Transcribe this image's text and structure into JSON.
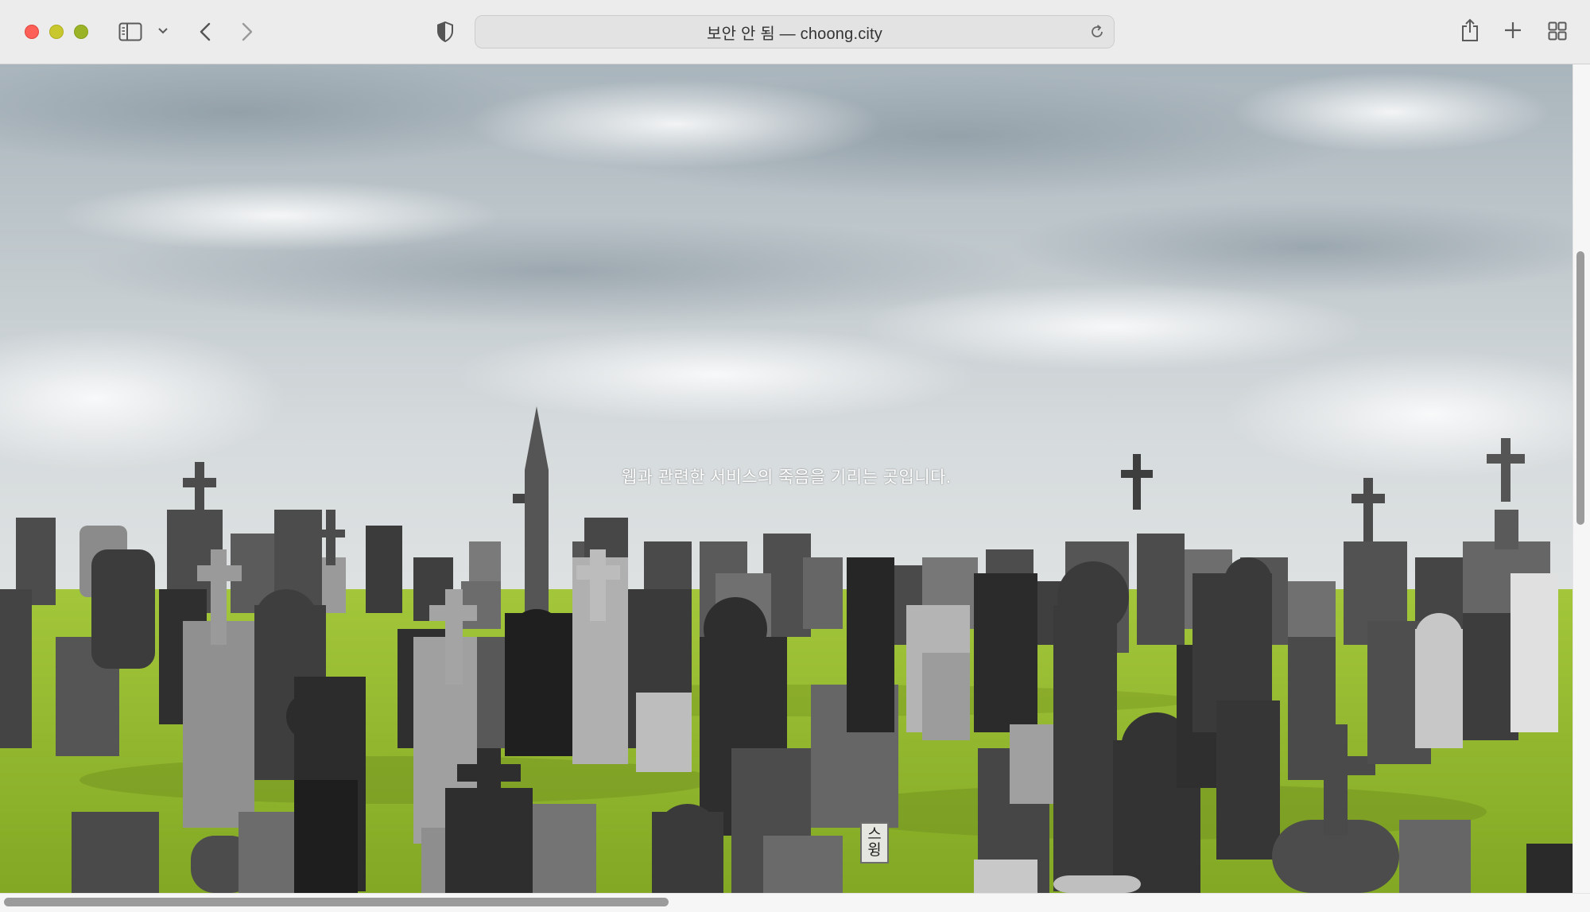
{
  "browser": {
    "address_bar": {
      "text": "보안 안 됨 — choong.city"
    },
    "icons": {
      "sidebar": "sidebar-icon",
      "sidebar_menu": "chevron-down-icon",
      "back": "chevron-left-icon",
      "forward": "chevron-right-icon",
      "privacy": "shield-icon",
      "reload": "reload-icon",
      "share": "share-icon",
      "new_tab": "plus-icon",
      "tab_overview": "grid-icon"
    }
  },
  "page": {
    "tagline": "웹과 관련한 서비스의 죽음을 기리는 곳입니다.",
    "vertical_button": {
      "chars": [
        "스",
        "윙"
      ]
    }
  },
  "colors": {
    "close": "#fe5f57",
    "minimize": "#c8c72d",
    "maximize": "#9bb327",
    "grass": "#8fb529",
    "sky": "#b9c2c6"
  }
}
